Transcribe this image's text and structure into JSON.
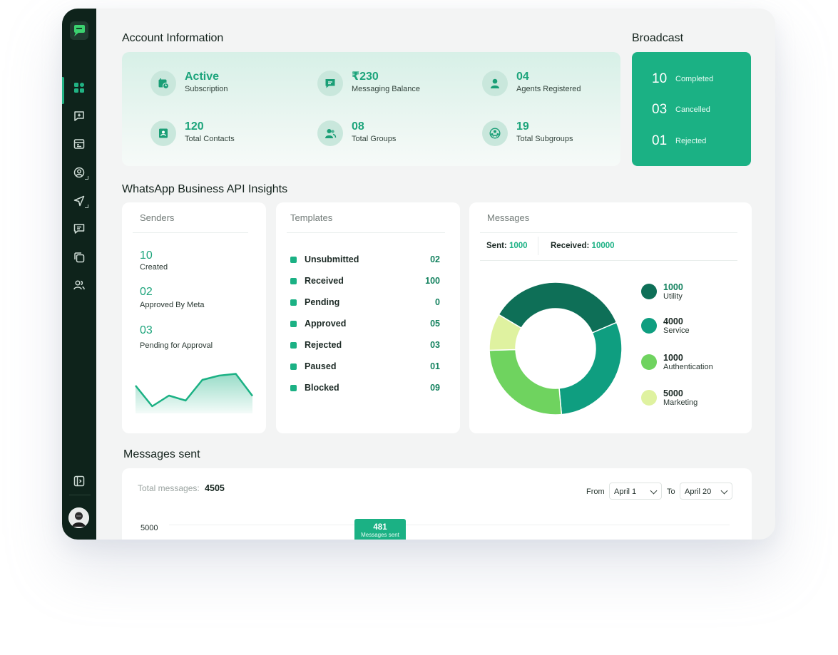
{
  "account": {
    "title": "Account Information",
    "items": [
      {
        "value": "Active",
        "label": "Subscription",
        "icon": "calendar-clock-icon"
      },
      {
        "value": "₹230",
        "label": "Messaging Balance",
        "icon": "message-balance-icon"
      },
      {
        "value": "04",
        "label": "Agents Registered",
        "icon": "agent-icon"
      },
      {
        "value": "120",
        "label": "Total Contacts",
        "icon": "contacts-book-icon"
      },
      {
        "value": "08",
        "label": "Total Groups",
        "icon": "group-icon"
      },
      {
        "value": "19",
        "label": "Total Subgroups",
        "icon": "subgroups-icon"
      }
    ]
  },
  "broadcast": {
    "title": "Broadcast",
    "rows": [
      {
        "value": "10",
        "label": "Completed"
      },
      {
        "value": "03",
        "label": "Cancelled"
      },
      {
        "value": "01",
        "label": "Rejected"
      }
    ]
  },
  "insights": {
    "title": "WhatsApp Business API Insights",
    "senders": {
      "title": "Senders",
      "items": [
        {
          "value": "10",
          "label": "Created"
        },
        {
          "value": "02",
          "label": "Approved By Meta"
        },
        {
          "value": "03",
          "label": "Pending for Approval"
        }
      ],
      "sparkline": [
        0.62,
        0.04,
        0.34,
        0.2,
        0.78,
        0.9,
        0.95,
        0.33
      ]
    },
    "templates": {
      "title": "Templates",
      "rows": [
        {
          "label": "Unsubmitted",
          "value": "02"
        },
        {
          "label": "Received",
          "value": "100"
        },
        {
          "label": "Pending",
          "value": "0"
        },
        {
          "label": "Approved",
          "value": "05"
        },
        {
          "label": "Rejected",
          "value": "03"
        },
        {
          "label": "Paused",
          "value": "01"
        },
        {
          "label": "Blocked",
          "value": "09"
        }
      ]
    },
    "messages": {
      "title": "Messages",
      "sent_label": "Sent:",
      "sent_value": "1000",
      "received_label": "Received:",
      "received_value": "10000",
      "legend": [
        {
          "value": "1000",
          "name": "Utility",
          "color": "#0e6f57"
        },
        {
          "value": "4000",
          "name": "Service",
          "color": "#0f9e80"
        },
        {
          "value": "1000",
          "name": "Authentication",
          "color": "#6fd35f"
        },
        {
          "value": "5000",
          "name": "Marketing",
          "color": "#dff2a0"
        }
      ]
    }
  },
  "messages_sent": {
    "title": "Messages sent",
    "total_label": "Total messages:",
    "total_value": "4505",
    "from_label": "From",
    "from_value": "April 1",
    "to_label": "To",
    "to_value": "April 20",
    "y_tick": "5000",
    "bar_value": "481",
    "bar_label": "Messages sent"
  },
  "chart_data": [
    {
      "type": "pie",
      "categories": [
        "Utility",
        "Service",
        "Authentication",
        "Marketing"
      ],
      "values": [
        35,
        30,
        26,
        9
      ]
    },
    {
      "type": "line",
      "values": [
        0.62,
        0.04,
        0.34,
        0.2,
        0.78,
        0.9,
        0.95,
        0.33
      ]
    }
  ]
}
